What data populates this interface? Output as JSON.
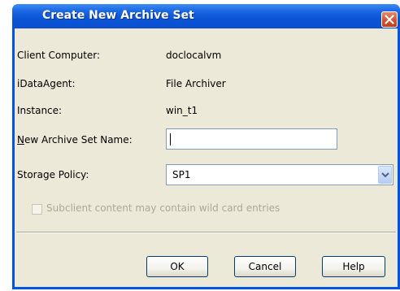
{
  "window": {
    "title": "Create New Archive Set"
  },
  "fields": {
    "client_label": "Client Computer:",
    "client_value": "doclocalvm",
    "agent_label": "iDataAgent:",
    "agent_value": "File Archiver",
    "instance_label": "Instance:",
    "instance_value": "win_t1",
    "archive_name_label_mnemonic": "N",
    "archive_name_label_rest": "ew Archive Set Name:",
    "archive_name_value": "",
    "storage_policy_label": "Storage Policy:",
    "storage_policy_value": "SP1"
  },
  "options": {
    "wildcard_label": "Subclient content may contain wild card entries",
    "wildcard_checked": false,
    "wildcard_enabled": false
  },
  "buttons": {
    "ok": "OK",
    "cancel": "Cancel",
    "help": "Help"
  },
  "icons": {
    "close": "close-icon",
    "dropdown": "chevron-down-icon"
  },
  "colors": {
    "titlebar": "#0a54d6",
    "dialog_bg": "#ece9d8",
    "close_button": "#d2522d",
    "disabled_text": "#aca899"
  }
}
